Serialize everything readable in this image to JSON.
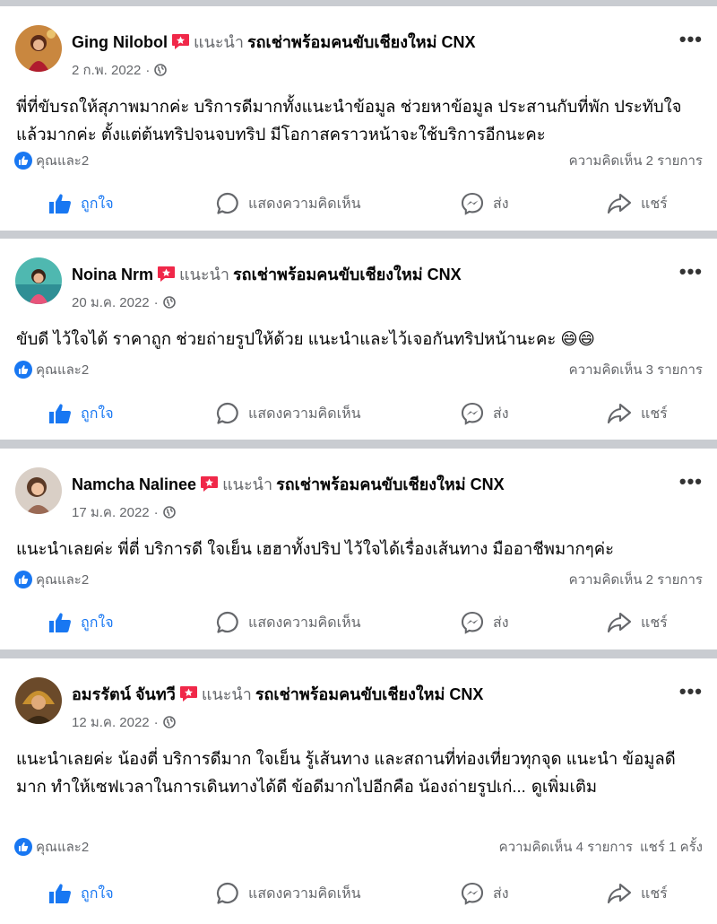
{
  "labels": {
    "recommend": "แนะนำ",
    "page_name": "รถเช่าพร้อมคนขับเชียงใหม่ CNX",
    "reactions": "คุณและ2",
    "like": "ถูกใจ",
    "comment": "แสดงความคิดเห็น",
    "send": "ส่ง",
    "share": "แชร์",
    "more": "•••",
    "dot": "·"
  },
  "posts": [
    {
      "author": "Ging Nilobol",
      "date": "2 ก.พ. 2022",
      "text": "พี่ที่ขับรถให้สุภาพมากค่ะ บริการดีมากทั้งแนะนำข้อมูล ช่วยหาข้อมูล ประสานกับที่พัก ประทับใจแล้วมากค่ะ ตั้งแต่ต้นทริปจนจบทริป  มีโอกาสคราวหน้าจะใช้บริการอีกนะคะ",
      "comments": "ความคิดเห็น 2 รายการ"
    },
    {
      "author": "Noina Nrm",
      "date": "20 ม.ค. 2022",
      "text": "ขับดี ไว้ใจได้ ราคาถูก  ช่วยถ่ายรูปให้ด้วย แนะนำและไว้เจอกันทริปหน้านะคะ 😄😄",
      "comments": "ความคิดเห็น 3 รายการ"
    },
    {
      "author": "Namcha Nalinee",
      "date": "17 ม.ค. 2022",
      "text": "แนะนำเลยค่ะ พี่ตี่ บริการดี ใจเย็น เฮฮาทั้งปริป ไว้ใจได้เรื่องเส้นทาง มืออาชีพมากๆค่ะ",
      "comments": "ความคิดเห็น 2 รายการ"
    },
    {
      "author": "อมรรัตน์ จันทวี",
      "date": "12 ม.ค. 2022",
      "text": "แนะนำเลยค่ะ น้องตี่ บริการดีมาก ใจเย็น รู้เส้นทาง และสถานที่ท่องเที่ยวทุกจุด แนะนำ ข้อมูลดีมาก ทำให้เซฟเวลาในการเดินทางได้ดี ข้อดีมากไปอีกคือ น้องถ่ายรูปเก่...",
      "see_more": "ดูเพิ่มเติม",
      "comments": "ความคิดเห็น 4 รายการ",
      "shares": "แชร์ 1 ครั้ง"
    }
  ]
}
